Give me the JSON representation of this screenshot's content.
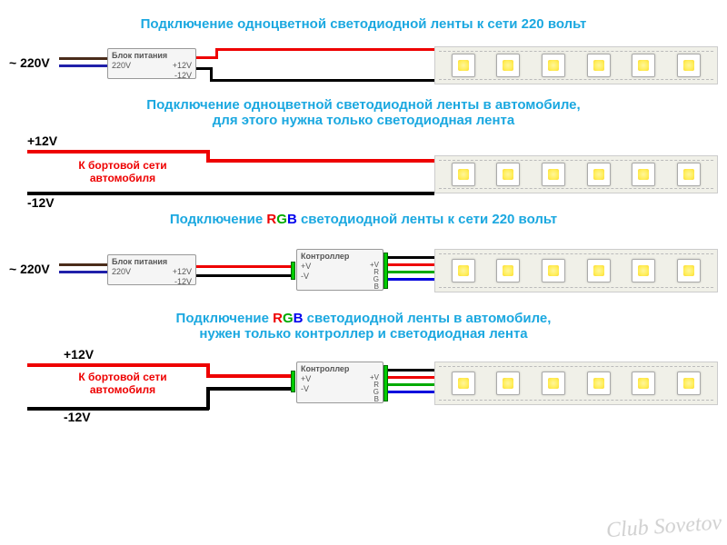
{
  "titles": {
    "t1": "Подключение одноцветной светодиодной ленты к сети 220 вольт",
    "t2a": "Подключение одноцветной светодиодной ленты в автомобиле,",
    "t2b": "для этого нужна только светодиодная лента",
    "t3_prefix": "Подключение ",
    "t3_suffix": " светодиодной ленты к сети 220 вольт",
    "t4a_prefix": "Подключение ",
    "t4a_suffix": " светодиодной ленты в автомобиле,",
    "t4b": "нужен только контроллер и светодиодная лента",
    "rgb_r": "R",
    "rgb_g": "G",
    "rgb_b": "B"
  },
  "labels": {
    "mains": "~ 220V",
    "plus12": "+12V",
    "minus12": "-12V",
    "onboard": "К бортовой сети автомобиля"
  },
  "box": {
    "psu_title": "Блок питания",
    "psu_in": "220V",
    "psu_out_p": "+12V",
    "psu_out_m": "-12V",
    "ctrl_title": "Контроллер",
    "ctrl_in_p": "+V",
    "ctrl_in_m": "-V",
    "ctrl_out_v": "+V",
    "ctrl_out_r": "R",
    "ctrl_out_g": "G",
    "ctrl_out_b": "B"
  },
  "watermark": "Club Sovetov"
}
